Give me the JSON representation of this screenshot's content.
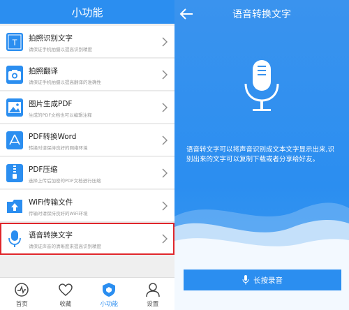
{
  "left": {
    "title": "小功能",
    "items": [
      {
        "title": "拍照识别文字",
        "desc": "请保证手机拍摄以提高识别精度",
        "icon": "text-recognition-icon"
      },
      {
        "title": "拍照翻译",
        "desc": "请保证手机拍摄以提高翻译的准确性",
        "icon": "camera-icon"
      },
      {
        "title": "图片生成PDF",
        "desc": "生成的PDF文档也可以编辑注释",
        "icon": "image-icon"
      },
      {
        "title": "PDF转换Word",
        "desc": "转换时请保持良好的网络环境",
        "icon": "pdf-icon"
      },
      {
        "title": "PDF压缩",
        "desc": "选择上传后加密的PDF文档进行压缩",
        "icon": "zip-icon"
      },
      {
        "title": "WiFi传输文件",
        "desc": "传输时请保持良好的WiFi环境",
        "icon": "folder-upload-icon"
      },
      {
        "title": "语音转换文字",
        "desc": "请保证声音的清晰度来提高识别精度",
        "icon": "microphone-icon"
      }
    ],
    "tabs": [
      {
        "label": "首页",
        "icon": "pulse-icon"
      },
      {
        "label": "收藏",
        "icon": "heart-icon"
      },
      {
        "label": "小功能",
        "icon": "shield-icon"
      },
      {
        "label": "设置",
        "icon": "user-icon"
      }
    ],
    "highlight_color": "#e0262b"
  },
  "right": {
    "title": "语音转换文字",
    "description": "语音转文字可以将声音识别成文本文字显示出来,识别出来的文字可以复制下载或者分享给好友。",
    "button_label": "长按录音",
    "accent": "#2b8ef0"
  }
}
